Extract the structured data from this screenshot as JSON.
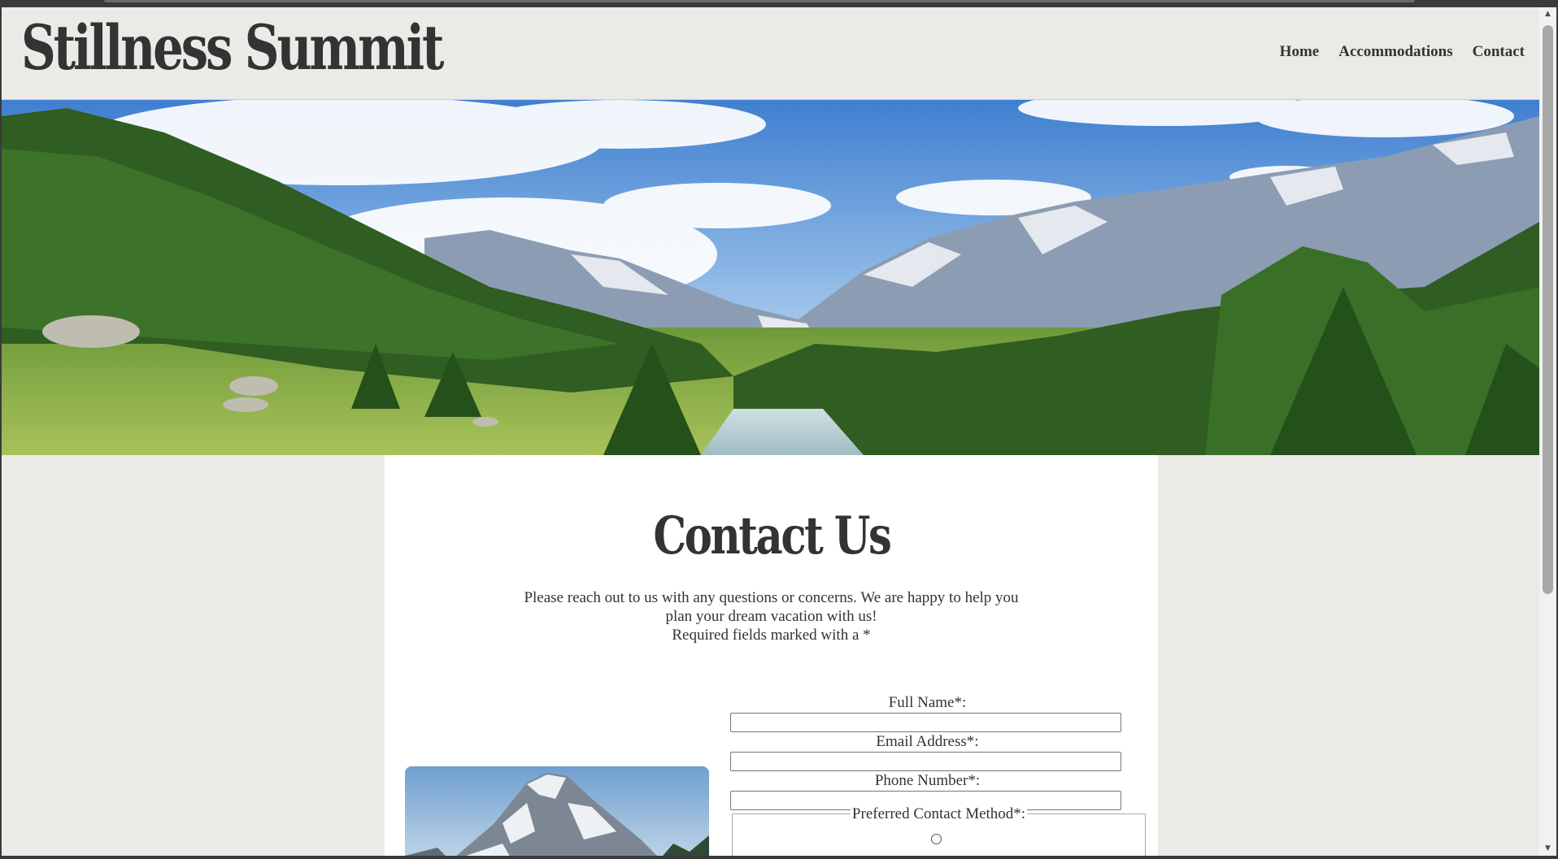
{
  "site": {
    "logo": "Stillness Summit"
  },
  "nav": {
    "items": [
      "Home",
      "Accommodations",
      "Contact"
    ]
  },
  "contact": {
    "title": "Contact Us",
    "intro_line1": "Please reach out to us with any questions or concerns. We are happy to help you",
    "intro_line2": "plan your dream vacation with us!",
    "required_note": "Required fields marked with a *"
  },
  "form": {
    "full_name_label": "Full Name*:",
    "email_label": "Email Address*:",
    "phone_label": "Phone Number*:",
    "contact_method_legend": "Preferred Contact Method*:",
    "full_name_value": "",
    "email_value": "",
    "phone_value": ""
  },
  "colors": {
    "page_bg": "#ebeae6",
    "text": "#333333",
    "card_bg": "#ffffff"
  }
}
